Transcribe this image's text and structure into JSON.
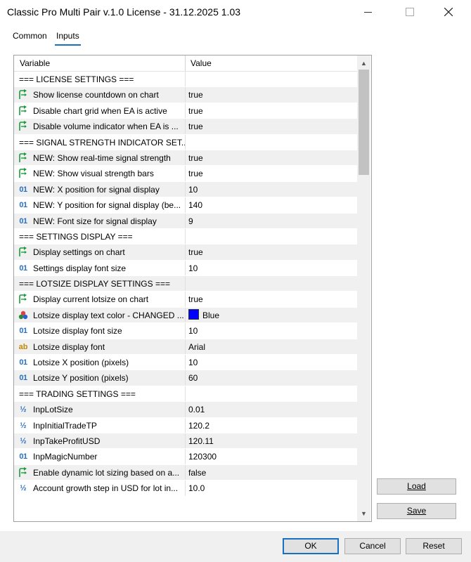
{
  "window": {
    "title": "Classic Pro Multi Pair v.1.0 License - 31.12.2025 1.03"
  },
  "tabs": [
    {
      "label": "Common"
    },
    {
      "label": "Inputs"
    }
  ],
  "table": {
    "headers": {
      "variable": "Variable",
      "value": "Value"
    },
    "rows": [
      {
        "type": "section",
        "label": "=== LICENSE SETTINGS ===",
        "value": ""
      },
      {
        "type": "bool",
        "label": "Show license countdown on chart",
        "value": "true"
      },
      {
        "type": "bool",
        "label": "Disable chart grid when EA is active",
        "value": "true"
      },
      {
        "type": "bool",
        "label": "Disable volume indicator when EA is ...",
        "value": "true"
      },
      {
        "type": "section",
        "label": "=== SIGNAL STRENGTH INDICATOR SET...",
        "value": ""
      },
      {
        "type": "bool",
        "label": "NEW: Show real-time signal strength",
        "value": "true"
      },
      {
        "type": "bool",
        "label": "NEW: Show visual strength bars",
        "value": "true"
      },
      {
        "type": "int",
        "label": "NEW: X position for signal display",
        "value": "10"
      },
      {
        "type": "int",
        "label": "NEW: Y position for signal display (be...",
        "value": "140"
      },
      {
        "type": "int",
        "label": "NEW: Font size for signal display",
        "value": "9"
      },
      {
        "type": "section",
        "label": "=== SETTINGS DISPLAY ===",
        "value": ""
      },
      {
        "type": "bool",
        "label": "Display settings on chart",
        "value": "true"
      },
      {
        "type": "int",
        "label": "Settings display font size",
        "value": "10"
      },
      {
        "type": "section",
        "label": "=== LOTSIZE DISPLAY SETTINGS ===",
        "value": ""
      },
      {
        "type": "bool",
        "label": "Display current lotsize on chart",
        "value": "true"
      },
      {
        "type": "color",
        "label": "Lotsize display text color - CHANGED ...",
        "value": "Blue",
        "color": "#0000ff"
      },
      {
        "type": "int",
        "label": "Lotsize display font size",
        "value": "10"
      },
      {
        "type": "string",
        "label": "Lotsize display font",
        "value": "Arial"
      },
      {
        "type": "int",
        "label": "Lotsize X position (pixels)",
        "value": "10"
      },
      {
        "type": "int",
        "label": "Lotsize Y position (pixels)",
        "value": "60"
      },
      {
        "type": "section",
        "label": "=== TRADING SETTINGS ===",
        "value": ""
      },
      {
        "type": "double",
        "label": "InpLotSize",
        "value": "0.01"
      },
      {
        "type": "double",
        "label": "InpInitialTradeTP",
        "value": "120.2"
      },
      {
        "type": "double",
        "label": "InpTakeProfitUSD",
        "value": "120.11"
      },
      {
        "type": "int",
        "label": "InpMagicNumber",
        "value": "120300"
      },
      {
        "type": "bool",
        "label": "Enable dynamic lot sizing based on a...",
        "value": "false"
      },
      {
        "type": "double",
        "label": "Account growth step in USD for lot in...",
        "value": "10.0"
      }
    ]
  },
  "icons": {
    "bool": "green-arrow-icon",
    "int": "integer-icon",
    "double": "fraction-icon",
    "string": "string-icon",
    "color": "palette-icon"
  },
  "icon_glyphs": {
    "int": "01",
    "double": "½",
    "string": "ab"
  },
  "buttons": {
    "load": "Load",
    "save": "Save",
    "ok": "OK",
    "cancel": "Cancel",
    "reset": "Reset"
  }
}
